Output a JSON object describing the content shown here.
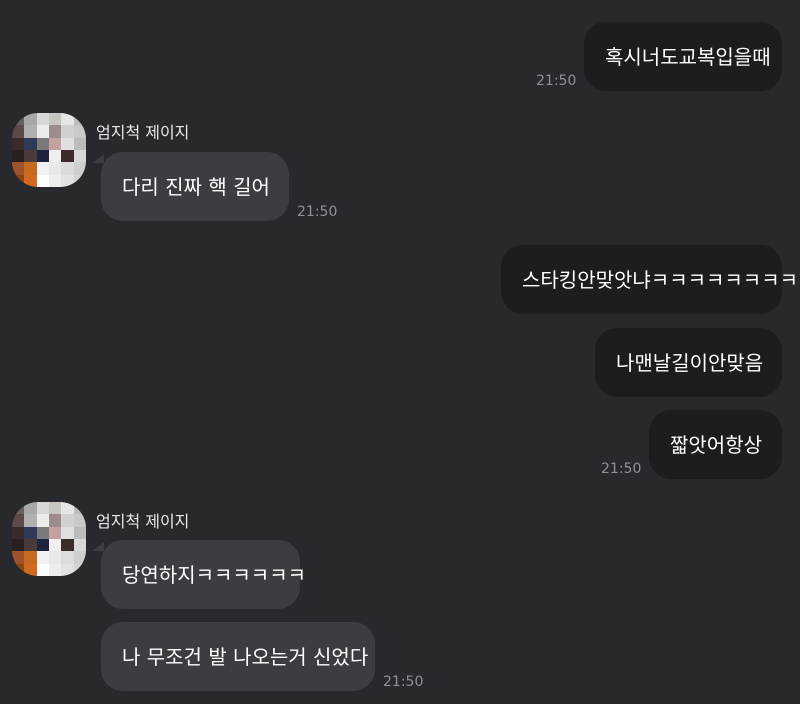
{
  "messages": [
    {
      "text": "혹시너도교복입을때",
      "time": "21:50"
    },
    {
      "sender": "엄지척 제이지",
      "text": "다리 진짜 핵 길어",
      "time": "21:50"
    },
    {
      "text": "스타킹안맞앗냐ㅋㅋㅋㅋㅋㅋㅋㅋㅋ"
    },
    {
      "text": "나맨날길이안맞음"
    },
    {
      "text": "짧앗어항상",
      "time": "21:50"
    },
    {
      "sender": "엄지척 제이지",
      "text": "당연하지ㅋㅋㅋㅋㅋㅋ"
    },
    {
      "text": "나 무조건 발 나오는거 신었다",
      "time": "21:50"
    }
  ],
  "avatar_colors": [
    "#6b6060",
    "#a8a8a8",
    "#d8d8d8",
    "#c8c4c0",
    "#e6e6e6",
    "#bdbdbd",
    "#5c4a4a",
    "#b0b0b0",
    "#ececec",
    "#9c8c8c",
    "#d0d0d0",
    "#c9c9c9",
    "#3a2a2a",
    "#2f3a58",
    "#7a7a7a",
    "#c4a0a0",
    "#e0e0e0",
    "#bcbcbc",
    "#2a1f1f",
    "#4a3a3a",
    "#1e2440",
    "#f0f0f0",
    "#3b2b2b",
    "#d8d8d8",
    "#a0522d",
    "#c56a1e",
    "#f2f2f2",
    "#e8e8e8",
    "#dcdcdc",
    "#cfcfcf",
    "#8b4513",
    "#d2691e",
    "#ffffff",
    "#ededed",
    "#e2e2e2",
    "#d5d5d5"
  ]
}
